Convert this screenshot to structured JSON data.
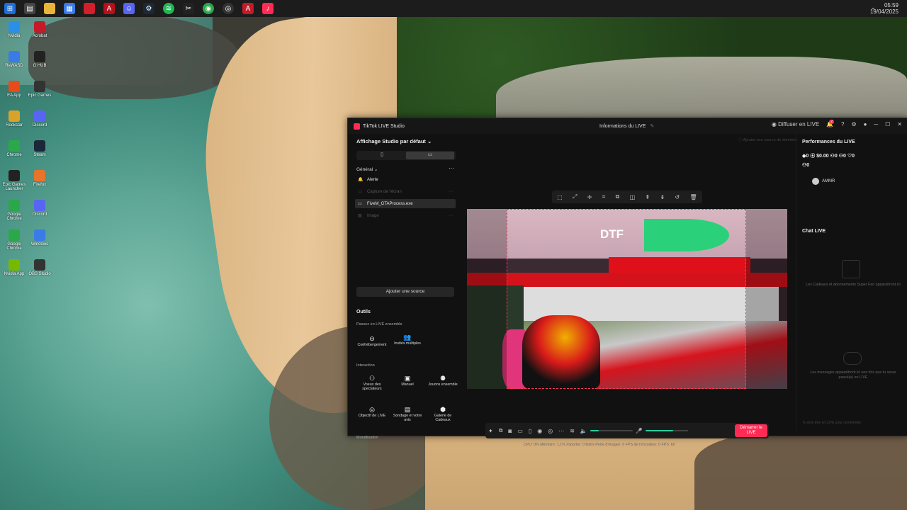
{
  "taskbar": {
    "clock_time": "05:59",
    "clock_date": "19/04/2025",
    "icons": [
      "windows-start-icon",
      "file-explorer-icon",
      "explorer-folder-icon",
      "calendar-icon",
      "red-app-icon",
      "acrobat-icon",
      "discord-icon",
      "steam-icon",
      "spotify-icon",
      "capcut-icon",
      "chrome-icon",
      "obs-icon",
      "adobe-icon",
      "tiktok-live-studio-icon"
    ]
  },
  "desktop_icons": [
    {
      "label": "Nvidia",
      "col": 0,
      "row": 0
    },
    {
      "label": "Acrobat",
      "col": 0,
      "row": 1
    },
    {
      "label": "ReWASD",
      "col": 0,
      "row": 2
    },
    {
      "label": "G HUB",
      "col": 0,
      "row": 3
    },
    {
      "label": "EA App",
      "col": 0,
      "row": 4
    },
    {
      "label": "Epic Games",
      "col": 0,
      "row": 5
    },
    {
      "label": "Rockstar",
      "col": 0,
      "row": 6
    },
    {
      "label": "Discord",
      "col": 0,
      "row": 7
    },
    {
      "label": "Chrome",
      "col": 0,
      "row": 8
    },
    {
      "label": "Steam",
      "col": 0,
      "row": 9
    },
    {
      "label": "Epic Games Launcher",
      "col": 0,
      "row": 10
    },
    {
      "label": "Firefox",
      "col": 0,
      "row": 11
    },
    {
      "label": "Google Chrome",
      "col": 0,
      "row": 12
    },
    {
      "label": "Discord",
      "col": 0,
      "row": 13
    },
    {
      "label": "Google Chrome",
      "col": 0,
      "row": 14
    },
    {
      "label": "Windows",
      "col": 0,
      "row": 15
    },
    {
      "label": "Nvidia App",
      "col": 0,
      "row": 16
    },
    {
      "label": "OBS Studio",
      "col": 0,
      "row": 17
    }
  ],
  "window": {
    "app_name": "TikTok LIVE Studio",
    "title": "Informations du LIVE",
    "share_label": "Diffuser en LIVE",
    "notification_count": "2"
  },
  "left_panel": {
    "layout_label": "Affichage Studio par défaut",
    "tab_portrait": "▯",
    "tab_landscape": "▭",
    "general_label": "Général",
    "sources": [
      {
        "label": "Alerte",
        "selected": false,
        "dim": false
      },
      {
        "label": "Capture de l'écran",
        "selected": false,
        "dim": true
      },
      {
        "label": "FiveM_GTAProcess.exe",
        "selected": true,
        "dim": false
      },
      {
        "label": "Image",
        "selected": false,
        "dim": true
      }
    ],
    "add_source": "Ajouter une source",
    "tools_title": "Outils",
    "section_live_together": "Passez en LIVE ensemble",
    "tool_cohost": "Coéhébergement",
    "tool_multi_guest": "Invités multiples",
    "section_interaction": "Interaction",
    "tool_viewers_voice": "Voeux des spectateurs",
    "tool_manual": "Manuel",
    "tool_play_together": "Jouons ensemble",
    "tool_live_goal": "Objectif de LIVE",
    "tool_poll": "Sondage et votre avis",
    "tool_gift_gallery": "Galerie de Cadeaux",
    "section_monetization": "Monétisation"
  },
  "preview": {
    "hint": "Ajouter une source de données",
    "scene_logo": "DTF",
    "start_button": "Démarrer le LIVE",
    "mic_level": 0.65,
    "stats": "CPU: 0%     Mémoire: 1,1%     Importer: 0 kbit/s     Perte d'images: 0     FPS de l'encodeur: 0     FPS: 60"
  },
  "right_panel": {
    "performance_title": "Performances du LIVE",
    "perf_row1": "◆0   ⦿ $0.00   ⚇0   ⚇0   ♡0",
    "perf_row2": "⚇0",
    "user_label": "AMMR",
    "chat_title": "Chat LIVE",
    "gift_info": "Les Cadeaux et abonnements Super Fan apparaîtront ici",
    "chat_empty": "Les messages apparaîtront ici une fois que tu seras passé(e) en LIVE",
    "chat_input_placeholder": "Tu dois être en LIVE pour commenter"
  }
}
